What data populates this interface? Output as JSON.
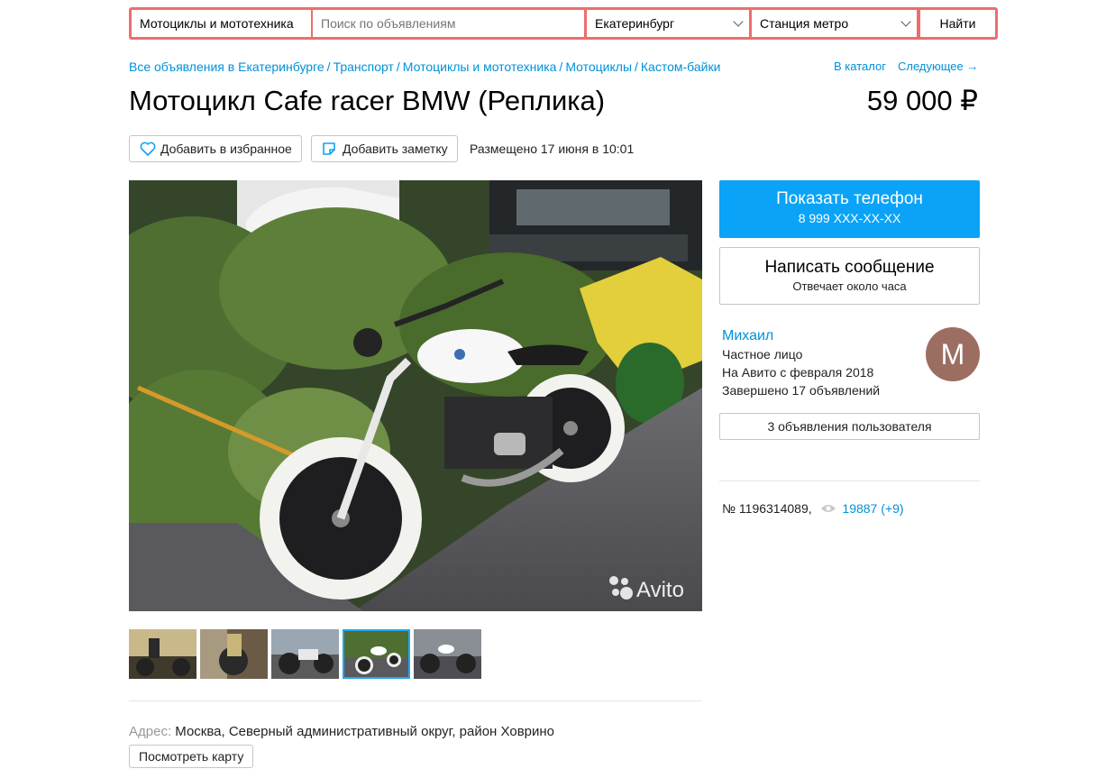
{
  "search": {
    "category": "Мотоциклы и мототехника",
    "placeholder": "Поиск по объявлениям",
    "city": "Екатеринбург",
    "metro": "Станция метро",
    "submit": "Найти"
  },
  "breadcrumbs": [
    "Все объявления в Екатеринбурге",
    "Транспорт",
    "Мотоциклы и мототехника",
    "Мотоциклы",
    "Кастом-байки"
  ],
  "breadcrumb_separator": "/",
  "nav": {
    "catalog": "В каталог",
    "next": "Следующее →"
  },
  "listing": {
    "title": "Мотоцикл Cafe racer BMW (Реплика)",
    "price": "59 000 ₽",
    "add_favorite": "Добавить в избранное",
    "add_note": "Добавить заметку",
    "posted": "Размещено 17 июня в 10:01",
    "watermark": "Avito",
    "address_label": "Адрес:",
    "address": "Москва, Северный административный округ, район Ховрино",
    "map_button": "Посмотреть карту",
    "ad_number": "№ 1196314089,",
    "views": "19887 (+9)",
    "active_thumbnail": 4
  },
  "contact": {
    "show_phone": "Показать телефон",
    "phone": "8 999 XXX-XX-XX",
    "write_message": "Написать сообщение",
    "response_time": "Отвечает около часа"
  },
  "seller": {
    "name": "Михаил",
    "type": "Частное лицо",
    "since": "На Авито с февраля 2018",
    "completed": "Завершено 17 объявлений",
    "avatar_letter": "М",
    "user_ads": "3 объявления пользователя"
  },
  "colors": {
    "accent_blue": "#0aa3f7",
    "link_blue": "#0091d9",
    "search_border": "#ec6e6e",
    "avatar_bg": "#9c6e61"
  }
}
